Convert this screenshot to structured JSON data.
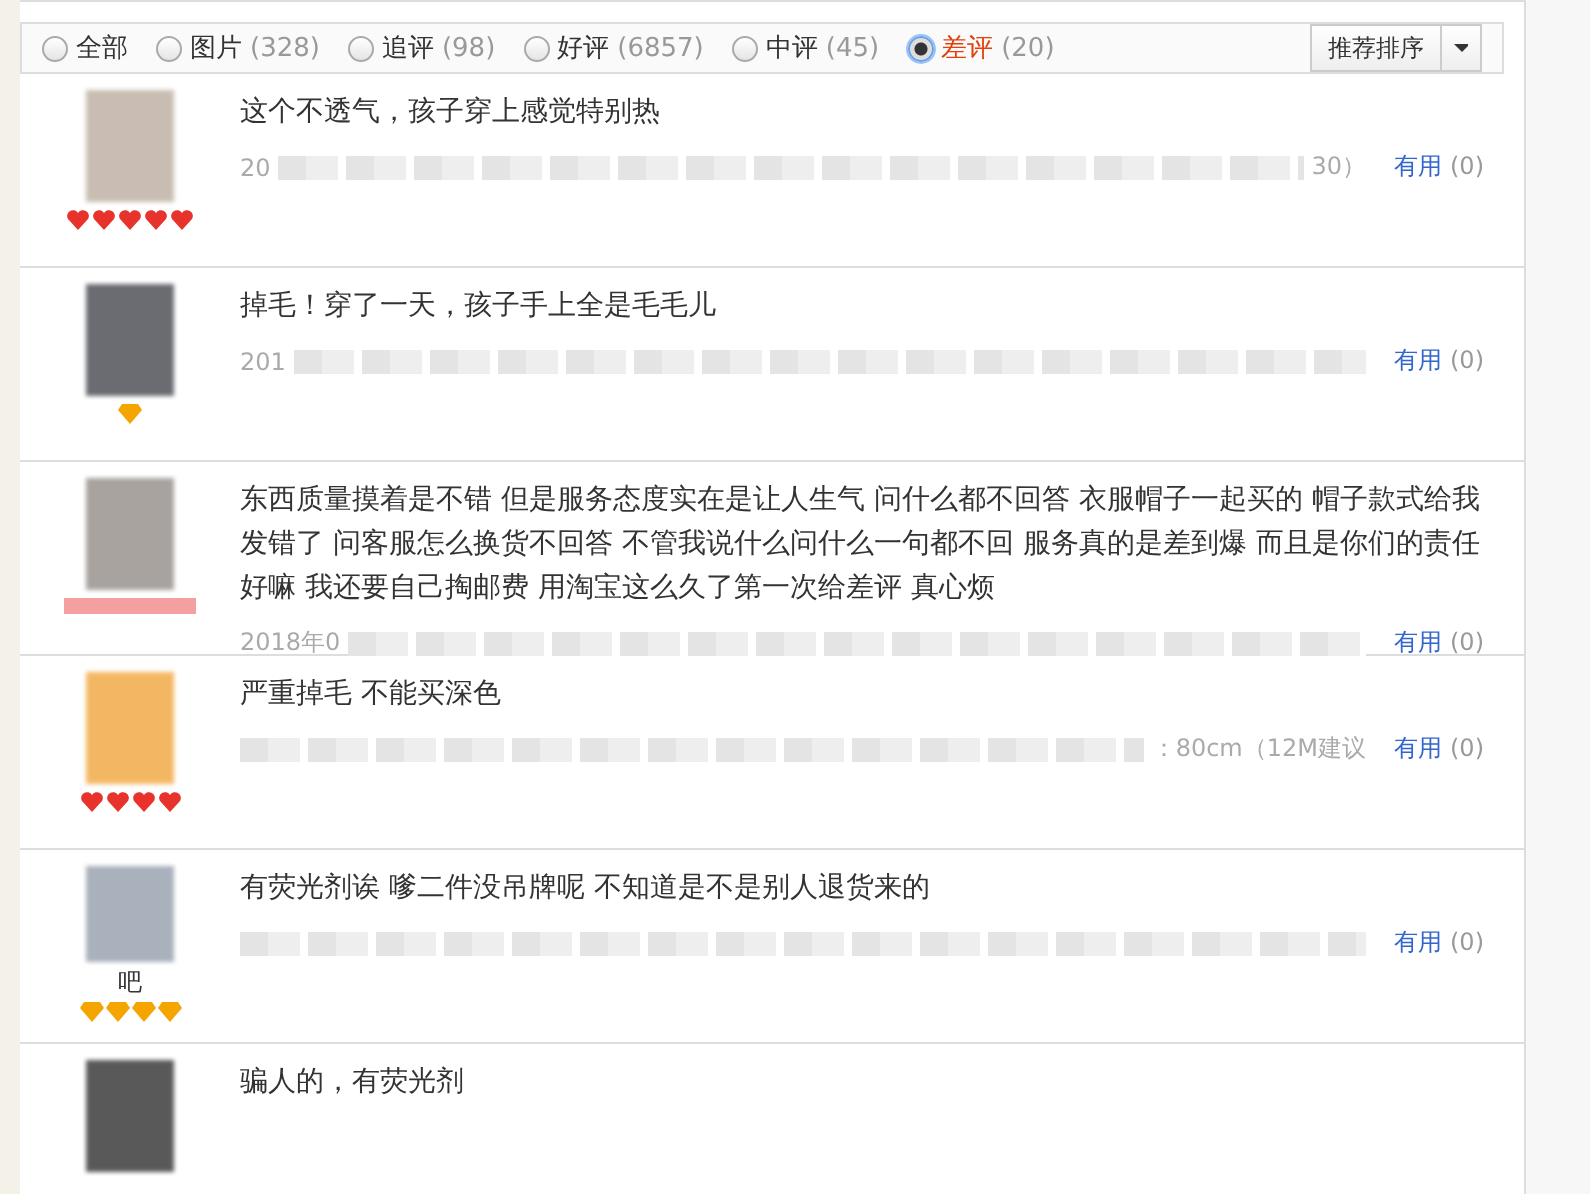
{
  "filters": [
    {
      "label": "全部",
      "selected": false
    },
    {
      "label": "图片",
      "count": "(328)",
      "selected": false
    },
    {
      "label": "追评",
      "count": "(98)",
      "selected": false
    },
    {
      "label": "好评",
      "count": "(6857)",
      "selected": false
    },
    {
      "label": "中评",
      "count": "(45)",
      "selected": false
    },
    {
      "label": "差评",
      "count": "(20)",
      "selected": true
    }
  ],
  "sort": {
    "label": "推荐排序"
  },
  "reviews": [
    {
      "text": "这个不透气，孩子穿上感觉特别热",
      "meta_prefix": "20",
      "meta_suffix": "30）",
      "badge": {
        "kind": "heart",
        "stars": 5
      },
      "useful": "有用",
      "useful_count": "(0)"
    },
    {
      "text": "掉毛！穿了一天，孩子手上全是毛毛儿",
      "meta_prefix": "201",
      "badge": {
        "kind": "diamond"
      },
      "useful": "有用",
      "useful_count": "(0)"
    },
    {
      "text": "东西质量摸着是不错 但是服务态度实在是让人生气 问什么都不回答 衣服帽子一起买的 帽子款式给我发错了 问客服怎么换货不回答 不管我说什么问什么一句都不回 服务真的是差到爆 而且是你们的责任好嘛 我还要自己掏邮费 用淘宝这么久了第一次给差评 真心烦",
      "meta_prefix": "2018年0",
      "badge": {
        "kind": "bar"
      },
      "useful": "有用",
      "useful_count": "(0)"
    },
    {
      "text": "严重掉毛 不能买深色",
      "meta_suffix": "：80cm（12M建议",
      "badge": {
        "kind": "heart",
        "stars": 4
      },
      "useful": "有用",
      "useful_count": "(0)"
    },
    {
      "text": "有荧光剂诶 嗲二件没吊牌呢 不知道是不是别人退货来的",
      "nickname": "吧",
      "badge": {
        "kind": "diamond",
        "stars": 4
      },
      "useful": "有用",
      "useful_count": "(0)"
    },
    {
      "text": "骗人的，有荧光剂"
    }
  ]
}
